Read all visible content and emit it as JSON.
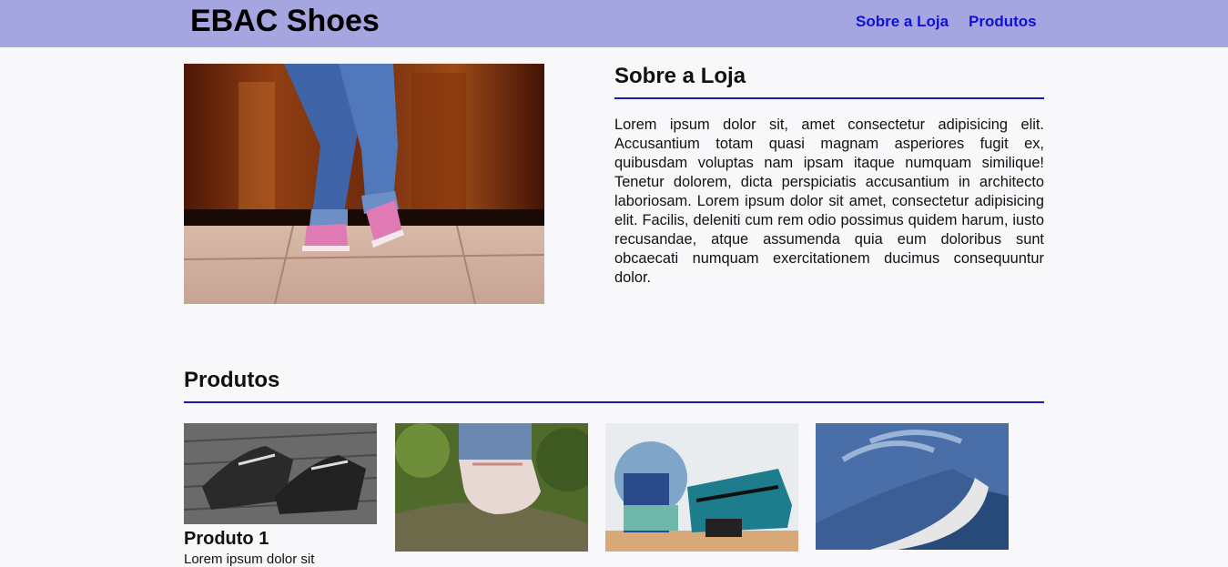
{
  "header": {
    "brand": "EBAC Shoes",
    "nav": [
      "Sobre a Loja",
      "Produtos"
    ]
  },
  "about": {
    "title": "Sobre a Loja",
    "text": "Lorem ipsum dolor sit, amet consectetur adipisicing elit. Accusantium totam quasi magnam asperiores fugit ex, quibusdam voluptas nam ipsam itaque numquam similique! Tenetur dolorem, dicta perspiciatis accusantium in architecto laboriosam. Lorem ipsum dolor sit amet, consectetur adipisicing elit. Facilis, deleniti cum rem odio possimus quidem harum, iusto recusandae, atque assumenda quia eum doloribus sunt obcaecati numquam exercitationem ducimus consequuntur dolor."
  },
  "products": {
    "title": "Produtos",
    "items": [
      {
        "title": "Produto 1",
        "desc": "Lorem ipsum dolor sit"
      }
    ]
  },
  "colors": {
    "header_bg": "#a5a6df",
    "nav_link": "#1010d8",
    "rule": "#1a1aa8",
    "page_bg": "#f8f8fb"
  }
}
